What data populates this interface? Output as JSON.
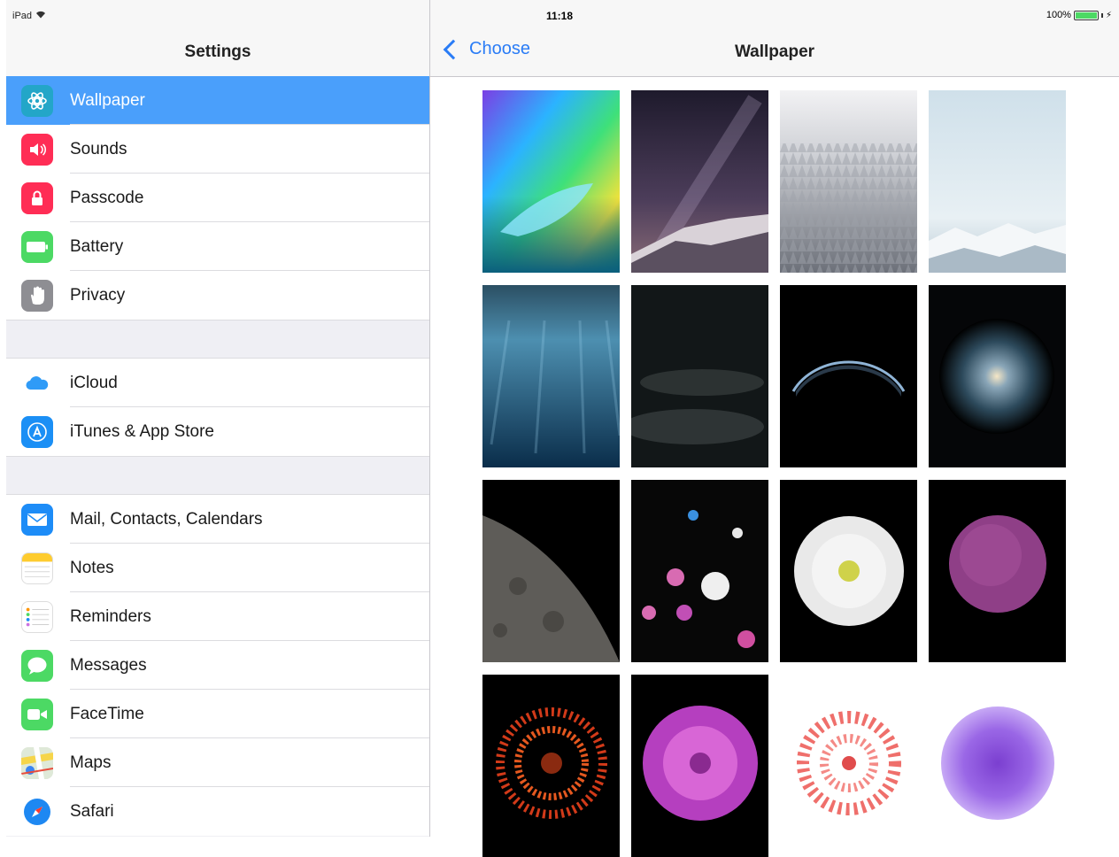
{
  "status_bar": {
    "device": "iPad",
    "time": "11:18",
    "battery_percent": "100%"
  },
  "left_pane": {
    "title": "Settings",
    "groups": [
      [
        {
          "label": "Wallpaper",
          "icon": "wallpaper-icon",
          "selected": true
        },
        {
          "label": "Sounds",
          "icon": "sounds-icon"
        },
        {
          "label": "Passcode",
          "icon": "passcode-icon"
        },
        {
          "label": "Battery",
          "icon": "battery-icon"
        },
        {
          "label": "Privacy",
          "icon": "privacy-icon"
        }
      ],
      [
        {
          "label": "iCloud",
          "icon": "icloud-icon"
        },
        {
          "label": "iTunes & App Store",
          "icon": "app-store-icon"
        }
      ],
      [
        {
          "label": "Mail, Contacts, Calendars",
          "icon": "mail-icon"
        },
        {
          "label": "Notes",
          "icon": "notes-icon"
        },
        {
          "label": "Reminders",
          "icon": "reminders-icon"
        },
        {
          "label": "Messages",
          "icon": "messages-icon"
        },
        {
          "label": "FaceTime",
          "icon": "facetime-icon"
        },
        {
          "label": "Maps",
          "icon": "maps-icon"
        },
        {
          "label": "Safari",
          "icon": "safari-icon"
        }
      ]
    ]
  },
  "right_pane": {
    "back_label": "Choose",
    "title": "Wallpaper",
    "wallpapers": [
      "rainbow-wave",
      "milky-way-mountain",
      "snowy-forest",
      "snowy-mountains",
      "underwater",
      "dark-clouds",
      "earth-horizon",
      "spiral-galaxy",
      "moon-surface",
      "flower-bouquet",
      "white-dahlia",
      "purple-hydrangea",
      "red-chrysanthemum",
      "magenta-dahlia",
      "pink-chrysanthemum-white",
      "purple-flower-white"
    ]
  },
  "colors": {
    "accent": "#2a7cf6",
    "selected_row": "#4a9ffb",
    "group_background": "#efeff4"
  }
}
